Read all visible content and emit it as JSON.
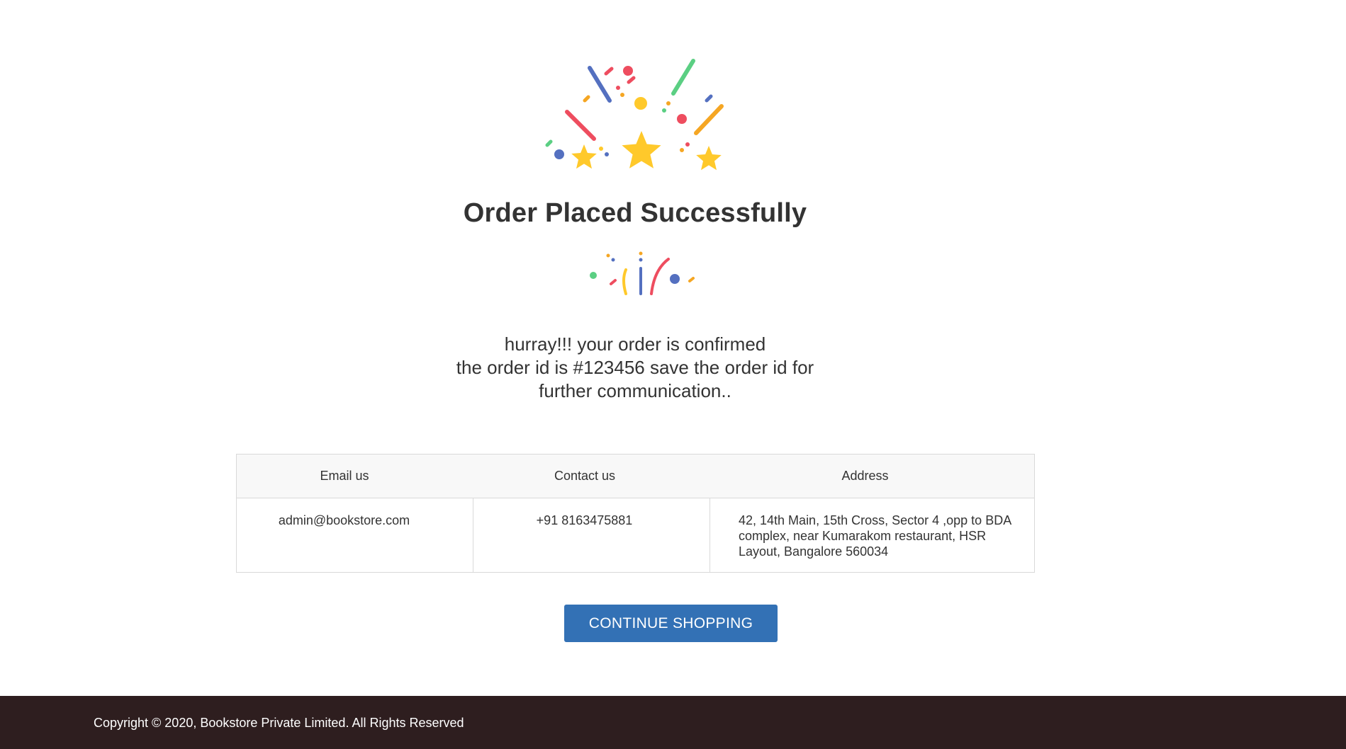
{
  "title": "Order Placed Successfully",
  "message": {
    "line1": "hurray!!! your order is confirmed",
    "line2": "the order id is #123456 save the order id for",
    "line3": "further communication.."
  },
  "info_table": {
    "headers": [
      "Email us",
      "Contact us",
      "Address"
    ],
    "values": {
      "email": "admin@bookstore.com",
      "contact": "+91 8163475881",
      "address": "42, 14th Main, 15th Cross, Sector 4 ,opp to BDA complex, near Kumarakom restaurant, HSR Layout, Bangalore 560034"
    }
  },
  "continue_button_label": "CONTINUE SHOPPING",
  "footer": {
    "copyright": "Copyright © 2020, Bookstore Private Limited. All Rights Reserved"
  },
  "colors": {
    "button": "#3371b5",
    "footer_bg": "#2e1e1f",
    "confetti_blue": "#5470c0",
    "confetti_red": "#ee4d5f",
    "confetti_green": "#5bcf83",
    "confetti_yellow": "#ffc92b",
    "confetti_orange": "#f5a623"
  },
  "icons": [
    "confetti-stars-icon",
    "confetti-burst-icon"
  ]
}
